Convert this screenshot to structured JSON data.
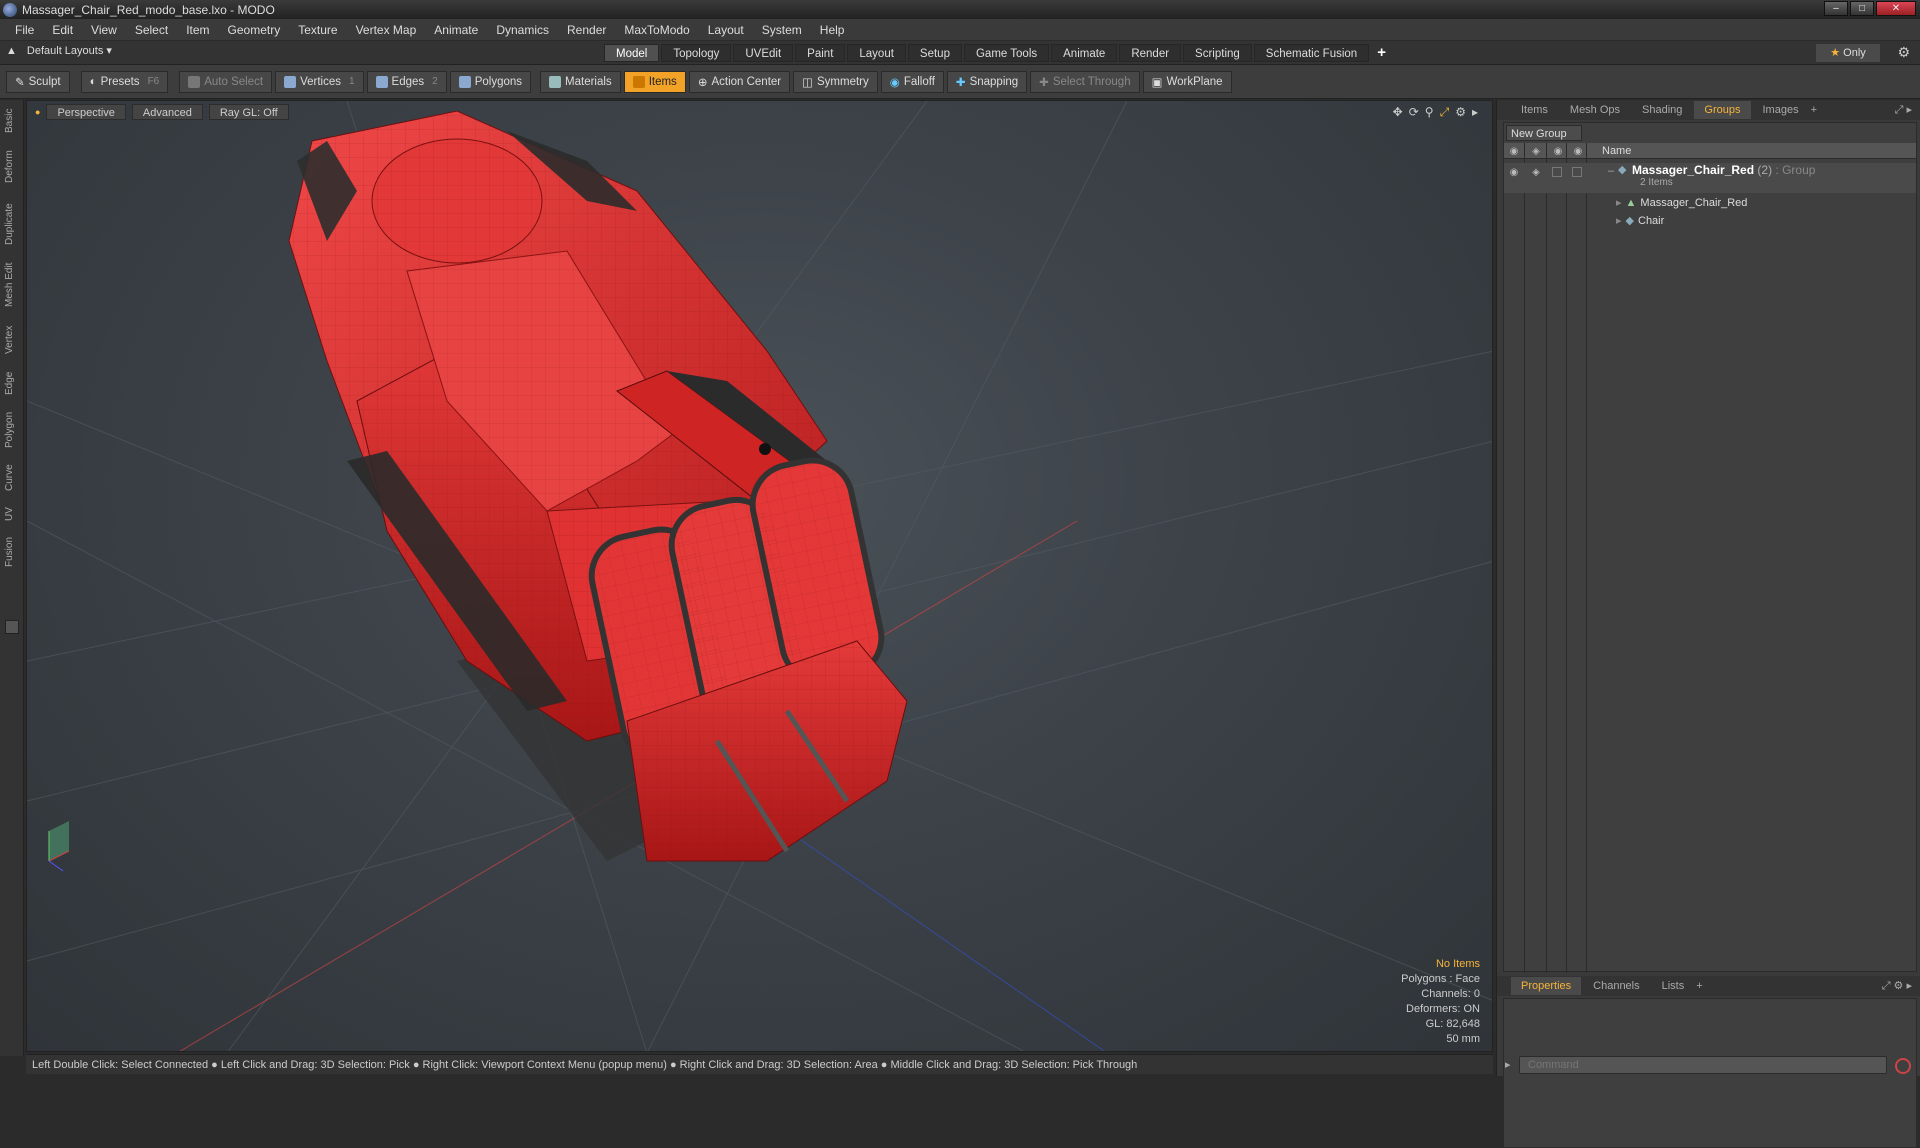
{
  "window": {
    "title": "Massager_Chair_Red_modo_base.lxo - MODO"
  },
  "menu": [
    "File",
    "Edit",
    "View",
    "Select",
    "Item",
    "Geometry",
    "Texture",
    "Vertex Map",
    "Animate",
    "Dynamics",
    "Render",
    "MaxToModo",
    "Layout",
    "System",
    "Help"
  ],
  "layout": {
    "selector": "Default Layouts",
    "tabs": [
      "Model",
      "Topology",
      "UVEdit",
      "Paint",
      "Layout",
      "Setup",
      "Game Tools",
      "Animate",
      "Render",
      "Scripting",
      "Schematic Fusion"
    ],
    "active_tab": "Model",
    "only_label": "Only"
  },
  "toolbar": {
    "sculpt": "Sculpt",
    "presets": "Presets",
    "presets_key": "F6",
    "auto_select": "Auto Select",
    "vertices": "Vertices",
    "vertices_key": "1",
    "edges": "Edges",
    "edges_key": "2",
    "polygons": "Polygons",
    "materials": "Materials",
    "items": "Items",
    "action_center": "Action Center",
    "symmetry": "Symmetry",
    "falloff": "Falloff",
    "snapping": "Snapping",
    "select_through": "Select Through",
    "workplane": "WorkPlane"
  },
  "left_strip": [
    "Basic",
    "Deform",
    "Duplicate",
    "Mesh Edit",
    "Vertex",
    "Edge",
    "Polygon",
    "Curve",
    "UV",
    "Fusion"
  ],
  "viewport": {
    "view": "Perspective",
    "shading": "Advanced",
    "raygl": "Ray GL: Off",
    "stats": {
      "items": "No Items",
      "polygons": "Polygons : Face",
      "channels": "Channels: 0",
      "deformers": "Deformers: ON",
      "gl": "GL: 82,648",
      "scale": "50 mm"
    }
  },
  "status_line": "Left Double Click: Select Connected ● Left Click and Drag: 3D Selection: Pick ● Right Click: Viewport Context Menu (popup menu) ● Right Click and Drag: 3D Selection: Area ● Middle Click and Drag: 3D Selection: Pick Through",
  "right_panel": {
    "tabs": [
      "Items",
      "Mesh Ops",
      "Shading",
      "Groups",
      "Images"
    ],
    "active_tab": "Groups",
    "new_group": "New Group",
    "list_header": "Name",
    "group": {
      "name": "Massager_Chair_Red",
      "count": "(2)",
      "type": ": Group",
      "subtitle": "2 Items",
      "children": [
        "Massager_Chair_Red",
        "Chair"
      ]
    },
    "bottom_tabs": [
      "Properties",
      "Channels",
      "Lists"
    ],
    "bottom_active": "Properties",
    "command_placeholder": "Command"
  },
  "colors": {
    "accent": "#f2a227",
    "chair_red": "#d92a2a",
    "viewport_bg": "#3d4349"
  }
}
